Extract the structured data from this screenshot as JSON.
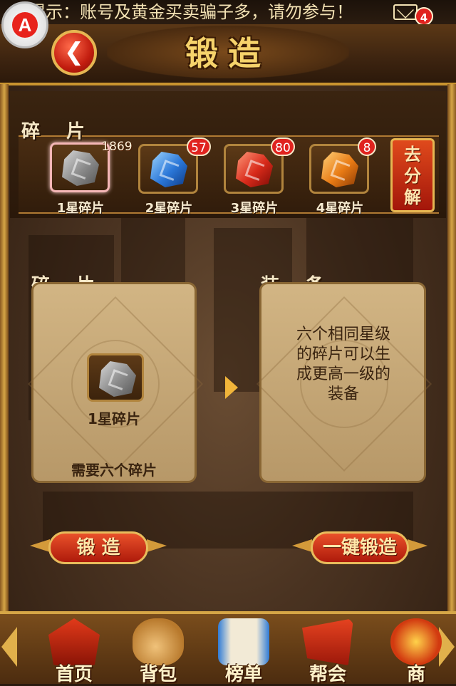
{
  "notice": "提示：账号及黄金买卖骗子多，请勿参与！",
  "mail_badge": "4",
  "app_logo_letter": "A",
  "title": "锻造",
  "shards_section_label": "碎 片",
  "shards": [
    {
      "label": "1星碎片",
      "count": "1869",
      "color": "#9a9a9a",
      "selected": true
    },
    {
      "label": "2星碎片",
      "count": "57",
      "color": "#2b77d8",
      "selected": false
    },
    {
      "label": "3星碎片",
      "count": "80",
      "color": "#d82a1a",
      "selected": false
    },
    {
      "label": "4星碎片",
      "count": "8",
      "color": "#e87a14",
      "selected": false
    }
  ],
  "decompose_button": "去分解",
  "left_panel": {
    "heading": "碎 片",
    "item_label": "1星碎片",
    "requirement": "需要六个碎片"
  },
  "right_panel": {
    "heading": "装 备",
    "hint": "六个相同星级的碎片可以生成更高一级的装备"
  },
  "forge_button": "锻 造",
  "forge_all_button": "一键锻造",
  "nav": [
    {
      "label": "首页",
      "icon": "palace-icon"
    },
    {
      "label": "背包",
      "icon": "bag-icon"
    },
    {
      "label": "榜单",
      "icon": "scroll-icon"
    },
    {
      "label": "帮会",
      "icon": "guild-icon"
    },
    {
      "label": "商",
      "icon": "shop-icon"
    }
  ],
  "colors": {
    "accent_gold": "#d6a646",
    "button_red": "#ae1a0b",
    "badge_red": "#e0231f"
  }
}
